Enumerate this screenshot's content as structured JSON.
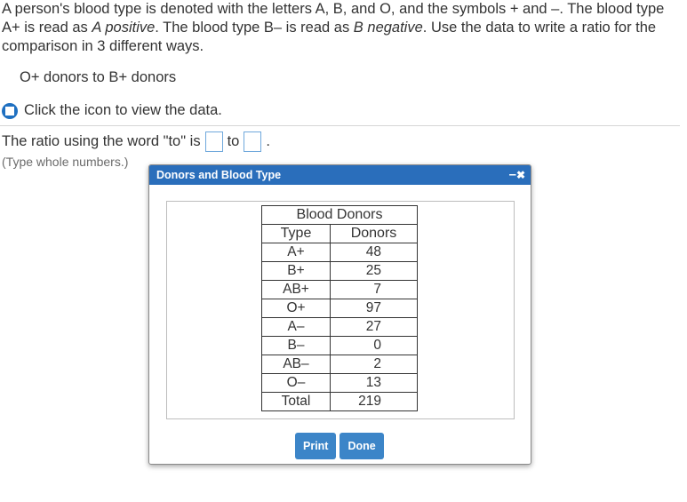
{
  "question": {
    "line_part1": "A person's blood type is denoted with the letters A, B, and O, and the symbols + and –. The blood type A+ is read as ",
    "italic1": "A positive",
    "line_part2": ". The blood type B– is read as ",
    "italic2": "B negative",
    "line_part3": ". Use the data to write a ratio for the comparison in 3 different ways."
  },
  "comparison": "O+ donors to B+ donors",
  "data_link_label": "Click the icon to view the data.",
  "answer": {
    "prefix": "The ratio using the word \"to\" is",
    "middle": "to",
    "suffix": ".",
    "hint": "(Type whole numbers.)",
    "box1_value": "",
    "box2_value": ""
  },
  "dialog": {
    "title": "Donors and Blood Type",
    "minimize_glyph": "–",
    "close_glyph": "✖",
    "table": {
      "title": "Blood Donors",
      "columns": [
        "Type",
        "Donors"
      ],
      "rows": [
        {
          "type": "A+",
          "donors": "48"
        },
        {
          "type": "B+",
          "donors": "25"
        },
        {
          "type": "AB+",
          "donors": "7"
        },
        {
          "type": "O+",
          "donors": "97"
        },
        {
          "type": "A–",
          "donors": "27"
        },
        {
          "type": "B–",
          "donors": "0"
        },
        {
          "type": "AB–",
          "donors": "2"
        },
        {
          "type": "O–",
          "donors": "13"
        },
        {
          "type": "Total",
          "donors": "219"
        }
      ]
    },
    "buttons": {
      "print": "Print",
      "done": "Done"
    }
  },
  "colors": {
    "dialog_header": "#2a6ebb",
    "button": "#3c85c8",
    "icon": "#1f70c1",
    "answer_box_border": "#6fa8dc"
  }
}
